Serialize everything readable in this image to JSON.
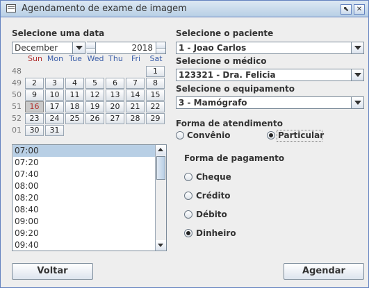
{
  "window": {
    "title": "Agendamento de exame de imagem",
    "minimize_icon": "⬉",
    "close_icon": "✕"
  },
  "left": {
    "date_label": "Selecione uma data",
    "month_value": "December",
    "year_value": "2018",
    "weekdays": [
      "Sun",
      "Mon",
      "Tue",
      "Wed",
      "Thu",
      "Fri",
      "Sat"
    ],
    "weeks": [
      {
        "num": "48",
        "days": [
          "",
          "",
          "",
          "",
          "",
          "",
          "1"
        ]
      },
      {
        "num": "49",
        "days": [
          "2",
          "3",
          "4",
          "5",
          "6",
          "7",
          "8"
        ]
      },
      {
        "num": "50",
        "days": [
          "9",
          "10",
          "11",
          "12",
          "13",
          "14",
          "15"
        ]
      },
      {
        "num": "51",
        "days": [
          "16",
          "17",
          "18",
          "19",
          "20",
          "21",
          "22"
        ]
      },
      {
        "num": "52",
        "days": [
          "23",
          "24",
          "25",
          "26",
          "27",
          "28",
          "29"
        ]
      },
      {
        "num": "01",
        "days": [
          "30",
          "31",
          "",
          "",
          "",
          "",
          ""
        ]
      }
    ],
    "selected_day": "16",
    "times": [
      "07:00",
      "07:20",
      "07:40",
      "08:00",
      "08:20",
      "08:40",
      "09:00",
      "09:20",
      "09:40"
    ],
    "selected_time": "07:00"
  },
  "right": {
    "patient_label": "Selecione o paciente",
    "patient_value": "1 - Joao Carlos",
    "doctor_label": "Selecione o médico",
    "doctor_value": "123321 - Dra. Felicia",
    "equipment_label": "Selecione o equipamento",
    "equipment_value": "3 - Mamógrafo",
    "attendance_label": "Forma de atendimento",
    "attendance_options": [
      "Convênio",
      "Particular"
    ],
    "attendance_selected": "Particular",
    "payment_label": "Forma de pagamento",
    "payment_options": [
      "Cheque",
      "Crédito",
      "Débito",
      "Dinheiro"
    ],
    "payment_selected": "Dinheiro"
  },
  "buttons": {
    "back": "Voltar",
    "schedule": "Agendar"
  }
}
